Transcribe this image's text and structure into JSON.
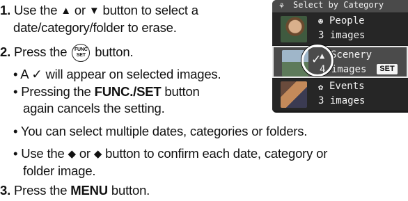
{
  "steps": {
    "s1_num": "1.",
    "s1_a": "Use the",
    "up_arrow": "▲",
    "s1_or": "or",
    "down_arrow": "▼",
    "s1_b": "button to select a",
    "s1_c": "date/category/folder to erase.",
    "s2_num": "2.",
    "s2_a": "Press the",
    "func_btn_line1": "FUNC",
    "func_btn_line2": "SET",
    "s2_b": "button.",
    "b1": "• A ✓ will appear on selected images.",
    "b2_a": "• Pressing the",
    "b2_bold": "FUNC./SET",
    "b2_b": "button",
    "b2_c": "again cancels the setting.",
    "b3": "• You can select multiple dates, categories or folders.",
    "b4_a": "• Use the",
    "left_arrow": "◆",
    "b4_or": "or",
    "right_arrow": "◆",
    "b4_b": "button to confirm each date, category or",
    "b4_c": "folder image.",
    "s3_num": "3.",
    "s3_a": "Press the",
    "s3_bold": "MENU",
    "s3_b": "button."
  },
  "screen": {
    "header": "Select by Category",
    "rows": [
      {
        "name": "People",
        "count": "3 images"
      },
      {
        "name": "Scenery",
        "count": "4 images",
        "selected": true
      },
      {
        "name": "Events",
        "count": "3 images"
      }
    ],
    "set_label": "SET",
    "check": "✓"
  }
}
